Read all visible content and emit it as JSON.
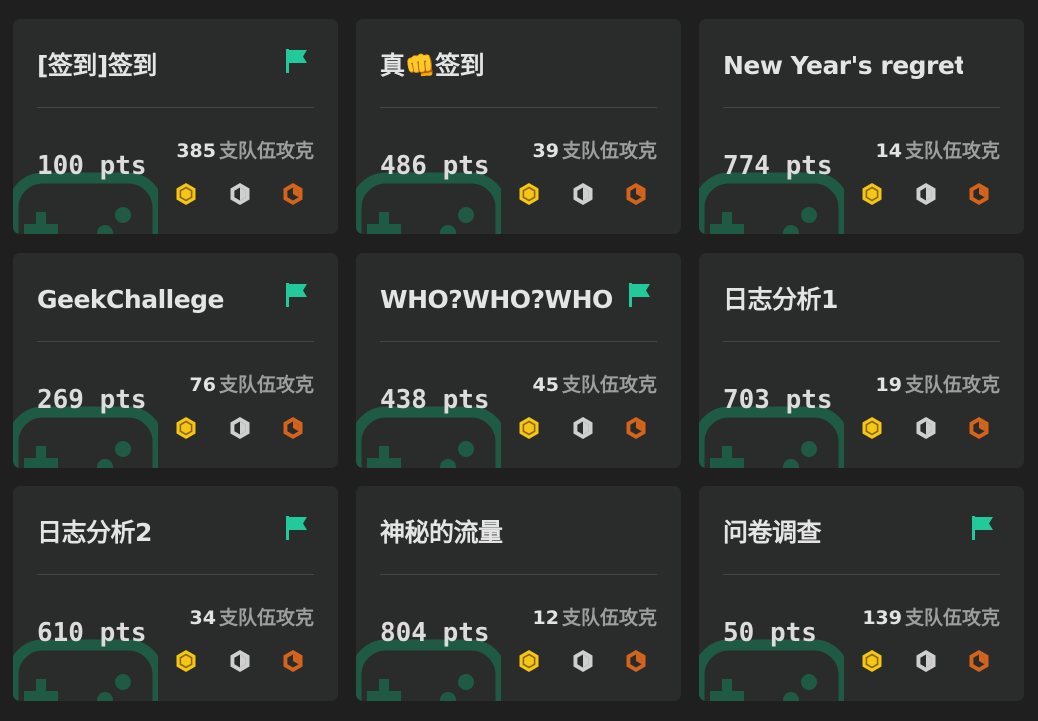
{
  "accent_color": "#22c99a",
  "solves_suffix": "支队伍攻克",
  "cards": [
    {
      "title": "[签到]签到",
      "points": "100 pts",
      "solves": "385",
      "solved": true
    },
    {
      "title": "真👊签到",
      "points": "486 pts",
      "solves": "39",
      "solved": false
    },
    {
      "title": "New Year's regret",
      "points": "774 pts",
      "solves": "14",
      "solved": false
    },
    {
      "title": "GeekChallege",
      "points": "269 pts",
      "solves": "76",
      "solved": true
    },
    {
      "title": "WHO?WHO?WHO",
      "points": "438 pts",
      "solves": "45",
      "solved": true
    },
    {
      "title": "日志分析1",
      "points": "703 pts",
      "solves": "19",
      "solved": false
    },
    {
      "title": "日志分析2",
      "points": "610 pts",
      "solves": "34",
      "solved": true
    },
    {
      "title": "神秘的流量",
      "points": "804 pts",
      "solves": "12",
      "solved": false
    },
    {
      "title": "问卷调查",
      "points": "50 pts",
      "solves": "139",
      "solved": true
    }
  ],
  "medal_colors": {
    "gold": "#f5c518",
    "silver": "#cfcfcf",
    "bronze": "#d4641b"
  },
  "icons": {
    "solved": "flag-icon",
    "background": "gamepad-icon",
    "medals": [
      "gold-medal-icon",
      "silver-medal-icon",
      "bronze-medal-icon"
    ]
  }
}
